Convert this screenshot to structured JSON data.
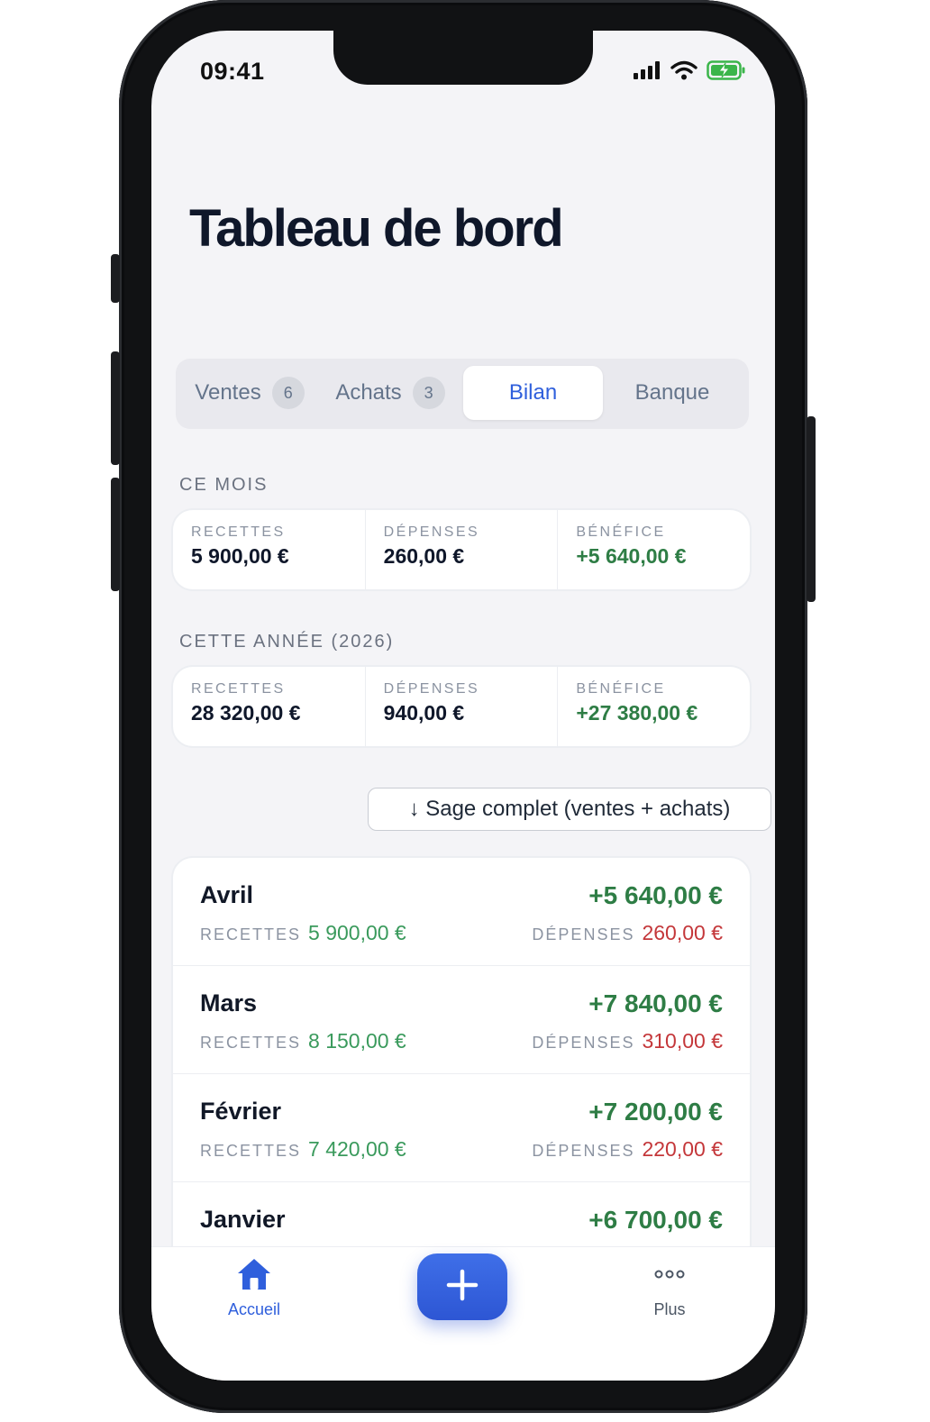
{
  "status_bar": {
    "time": "09:41"
  },
  "page": {
    "title": "Tableau de bord"
  },
  "tabs": [
    {
      "label": "Ventes",
      "badge": "6"
    },
    {
      "label": "Achats",
      "badge": "3"
    },
    {
      "label": "Bilan",
      "badge": null
    },
    {
      "label": "Banque",
      "badge": null
    }
  ],
  "active_tab": "Bilan",
  "this_month": {
    "section_label": "CE MOIS",
    "stats": [
      {
        "label": "RECETTES",
        "value": "5 900,00 €"
      },
      {
        "label": "DÉPENSES",
        "value": "260,00 €"
      },
      {
        "label": "BÉNÉFICE",
        "value": "+5 640,00 €"
      }
    ]
  },
  "this_year": {
    "section_label": "CETTE ANNÉE (2026)",
    "stats": [
      {
        "label": "RECETTES",
        "value": "28 320,00 €"
      },
      {
        "label": "DÉPENSES",
        "value": "940,00 €"
      },
      {
        "label": "BÉNÉFICE",
        "value": "+27 380,00 €"
      }
    ]
  },
  "export_button": {
    "label": "↓ Sage complet (ventes + achats)"
  },
  "month_labels": {
    "income": "RECETTES",
    "expense": "DÉPENSES"
  },
  "months": [
    {
      "name": "Avril",
      "profit": "+5 640,00 €",
      "income": "5 900,00 €",
      "expense": "260,00 €"
    },
    {
      "name": "Mars",
      "profit": "+7 840,00 €",
      "income": "8 150,00 €",
      "expense": "310,00 €"
    },
    {
      "name": "Février",
      "profit": "+7 200,00 €",
      "income": "7 420,00 €",
      "expense": "220,00 €"
    },
    {
      "name": "Janvier",
      "profit": "+6 700,00 €",
      "income": "",
      "expense": ""
    }
  ],
  "tab_bar": {
    "home_label": "Accueil",
    "more_label": "Plus",
    "home_icon": "house-icon",
    "add_icon": "plus-icon",
    "more_icon": "ellipsis-icon"
  },
  "colors": {
    "accent": "#2f5fdc",
    "positive": "#2e7d45",
    "negative": "#c4373a",
    "background": "#f4f4f7"
  }
}
